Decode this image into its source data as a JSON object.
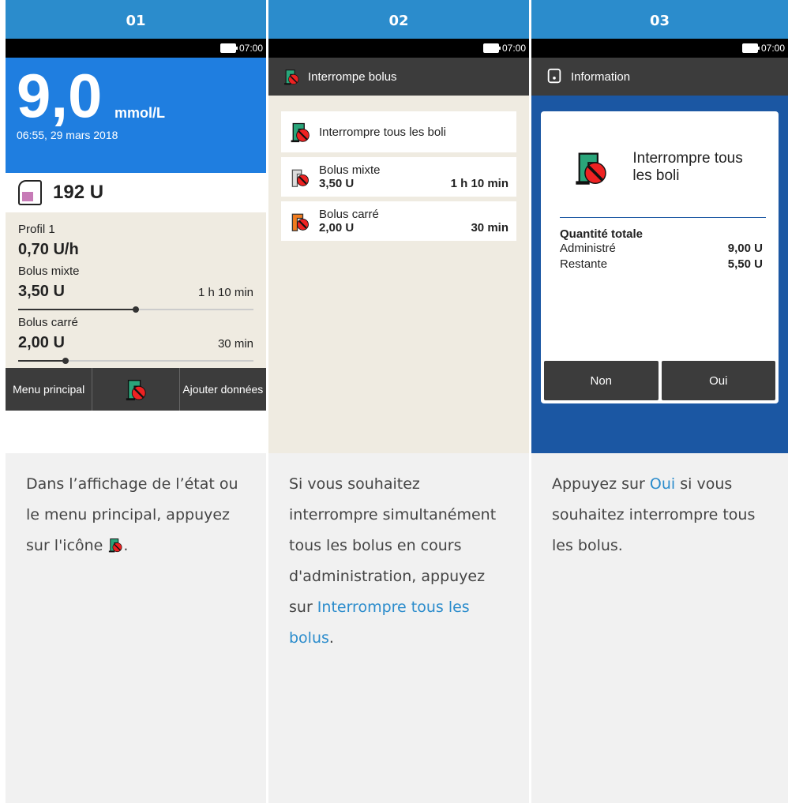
{
  "columns": [
    {
      "number": "01"
    },
    {
      "number": "02"
    },
    {
      "number": "03"
    }
  ],
  "status": {
    "time": "07:00"
  },
  "screen1": {
    "glucose_value": "9,0",
    "glucose_unit": "mmol/L",
    "datetime": "06:55, 29 mars 2018",
    "reservoir": "192 U",
    "profile_label": "Profil 1",
    "profile_rate": "0,70 U/h",
    "bolus1_label": "Bolus mixte",
    "bolus1_value": "3,50 U",
    "bolus1_time": "1 h 10 min",
    "bolus1_progress": 0.5,
    "bolus2_label": "Bolus carré",
    "bolus2_value": "2,00 U",
    "bolus2_time": "30 min",
    "bolus2_progress": 0.2,
    "menu_label": "Menu principal",
    "add_data_label": "Ajouter données"
  },
  "screen2": {
    "title": "Interrompe bolus",
    "all_label": "Interrompre tous les boli",
    "items": [
      {
        "name": "Bolus mixte",
        "amount": "3,50 U",
        "time": "1 h 10 min"
      },
      {
        "name": "Bolus carré",
        "amount": "2,00 U",
        "time": "30 min"
      }
    ]
  },
  "screen3": {
    "title": "Information",
    "dialog_title": "Interrompre tous les boli",
    "total_label": "Quantité totale",
    "administered_label": "Administré",
    "administered_value": "9,00 U",
    "remaining_label": "Restante",
    "remaining_value": "5,50 U",
    "no_label": "Non",
    "yes_label": "Oui"
  },
  "descriptions": {
    "d1_part1": "Dans l’affichage de l’état ou le menu principal, appuyez sur l'icône ",
    "d1_part2": ".",
    "d2_part1": "Si vous souhaitez interrompre simultanément tous les bolus en cours d'administration, appuyez sur ",
    "d2_link": "Interrompre tous les bolus",
    "d2_part2": ".",
    "d3_part1": "Appuyez sur ",
    "d3_link": "Oui",
    "d3_part2": " si vous souhaitez interrompre tous les bolus."
  },
  "colors": {
    "accent": "#2b8ccc",
    "screen_blue": "#1f7ee0",
    "dialog_blue": "#1b57a3",
    "panel_beige": "#efebe1"
  },
  "icons": [
    "battery-icon",
    "stop-bolus-icon",
    "reservoir-icon",
    "extended-bolus-icon",
    "multiwave-bolus-icon",
    "info-icon"
  ]
}
